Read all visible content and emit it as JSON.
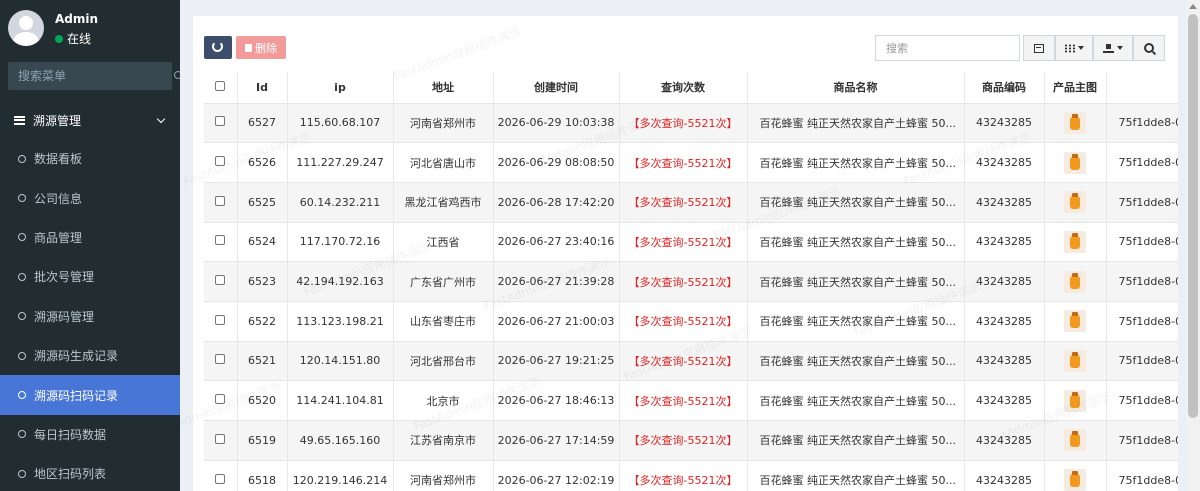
{
  "user": {
    "name": "Admin",
    "status": "在线"
  },
  "sidebar": {
    "search_placeholder": "搜索菜单",
    "section": "溯源管理",
    "items": [
      {
        "label": "数据看板"
      },
      {
        "label": "公司信息"
      },
      {
        "label": "商品管理"
      },
      {
        "label": "批次号管理"
      },
      {
        "label": "溯源码管理"
      },
      {
        "label": "溯源码生成记录"
      },
      {
        "label": "溯源码扫码记录",
        "active": true
      },
      {
        "label": "每日扫码数据"
      },
      {
        "label": "地区扫码列表"
      }
    ]
  },
  "toolbar": {
    "delete_label": "删除",
    "search_placeholder": "搜索"
  },
  "table": {
    "headers": {
      "id": "Id",
      "ip": "ip",
      "address": "地址",
      "created": "创建时间",
      "count": "查询次数",
      "product": "商品名称",
      "code": "商品编码",
      "image": "产品主图"
    },
    "rows": [
      {
        "id": "6527",
        "ip": "115.60.68.107",
        "address": "河南省郑州市",
        "created": "2026-06-29 10:03:38",
        "count": "【多次查询-5521次】",
        "product": "百花蜂蜜 纯正天然农家自产土蜂蜜 50...",
        "code": "43243285",
        "trace": "75f1dde8-0"
      },
      {
        "id": "6526",
        "ip": "111.227.29.247",
        "address": "河北省唐山市",
        "created": "2026-06-29 08:08:50",
        "count": "【多次查询-5521次】",
        "product": "百花蜂蜜 纯正天然农家自产土蜂蜜 50...",
        "code": "43243285",
        "trace": "75f1dde8-0"
      },
      {
        "id": "6525",
        "ip": "60.14.232.211",
        "address": "黑龙江省鸡西市",
        "created": "2026-06-28 17:42:20",
        "count": "【多次查询-5521次】",
        "product": "百花蜂蜜 纯正天然农家自产土蜂蜜 50...",
        "code": "43243285",
        "trace": "75f1dde8-0"
      },
      {
        "id": "6524",
        "ip": "117.170.72.16",
        "address": "江西省",
        "created": "2026-06-27 23:40:16",
        "count": "【多次查询-5521次】",
        "product": "百花蜂蜜 纯正天然农家自产土蜂蜜 50...",
        "code": "43243285",
        "trace": "75f1dde8-0"
      },
      {
        "id": "6523",
        "ip": "42.194.192.163",
        "address": "广东省广州市",
        "created": "2026-06-27 21:39:28",
        "count": "【多次查询-5521次】",
        "product": "百花蜂蜜 纯正天然农家自产土蜂蜜 50...",
        "code": "43243285",
        "trace": "75f1dde8-0"
      },
      {
        "id": "6522",
        "ip": "113.123.198.21",
        "address": "山东省枣庄市",
        "created": "2026-06-27 21:00:03",
        "count": "【多次查询-5521次】",
        "product": "百花蜂蜜 纯正天然农家自产土蜂蜜 50...",
        "code": "43243285",
        "trace": "75f1dde8-0"
      },
      {
        "id": "6521",
        "ip": "120.14.151.80",
        "address": "河北省邢台市",
        "created": "2026-06-27 19:21:25",
        "count": "【多次查询-5521次】",
        "product": "百花蜂蜜 纯正天然农家自产土蜂蜜 50...",
        "code": "43243285",
        "trace": "75f1dde8-0"
      },
      {
        "id": "6520",
        "ip": "114.241.104.81",
        "address": "北京市",
        "created": "2026-06-27 18:46:13",
        "count": "【多次查询-5521次】",
        "product": "百花蜂蜜 纯正天然农家自产土蜂蜜 50...",
        "code": "43243285",
        "trace": "75f1dde8-0"
      },
      {
        "id": "6519",
        "ip": "49.65.165.160",
        "address": "江苏省南京市",
        "created": "2026-06-27 17:14:59",
        "count": "【多次查询-5521次】",
        "product": "百花蜂蜜 纯正天然农家自产土蜂蜜 50...",
        "code": "43243285",
        "trace": "75f1dde8-0"
      },
      {
        "id": "6518",
        "ip": "120.219.146.214",
        "address": "河南省郑州市",
        "created": "2026-06-27 12:02:19",
        "count": "【多次查询-5521次】",
        "product": "百花蜂蜜 纯正天然农家自产土蜂蜜 50...",
        "code": "43243285",
        "trace": "75f1dde8-0"
      }
    ]
  },
  "watermark": "FastAdmin应用插件演示"
}
